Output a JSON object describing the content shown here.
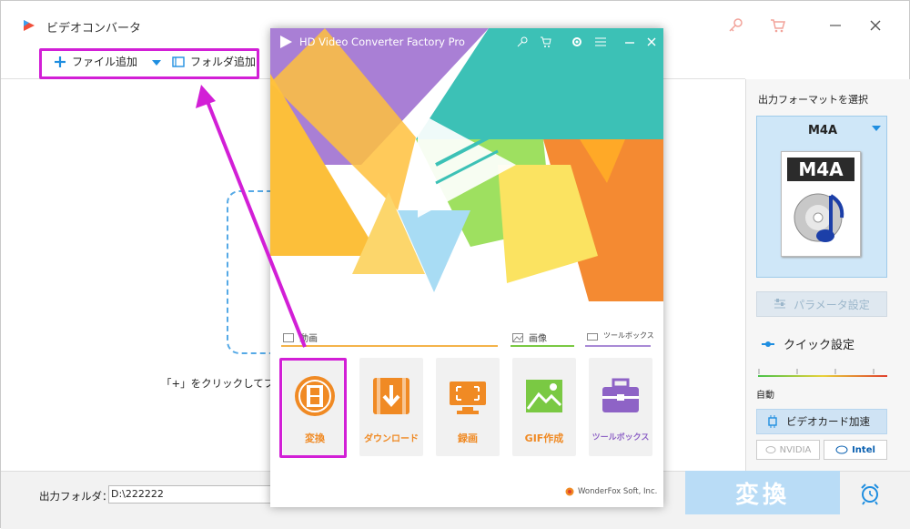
{
  "window": {
    "title": "ビデオコンバータ"
  },
  "toolbar": {
    "add_file": "ファイル追加",
    "add_folder": "フォルダ追加"
  },
  "main": {
    "hint": "「+」をクリックしてフ"
  },
  "output_format": {
    "label": "出力フォーマットを選択",
    "selected": "M4A",
    "icon_text": "M4A",
    "param_button": "パラメータ設定"
  },
  "quick_settings": {
    "label": "クイック設定",
    "auto": "自動"
  },
  "gpu": {
    "label": "ビデオカード加速",
    "vendors": [
      "NVIDIA",
      "Intel"
    ]
  },
  "bottom": {
    "output_label": "出力フォルダ：",
    "output_path": "D:\\222222",
    "convert": "変換"
  },
  "overlay": {
    "title": "HD Video Converter Factory Pro",
    "sections": {
      "video": "動画",
      "image": "画像",
      "toolbox": "ツールボックス"
    },
    "cards": [
      {
        "label": "変換",
        "color": "#f08a24"
      },
      {
        "label": "ダウンロード",
        "color": "#f08a24"
      },
      {
        "label": "録画",
        "color": "#f08a24"
      },
      {
        "label": "GIF作成",
        "color": "#f08a24"
      },
      {
        "label": "ツールボックス",
        "color": "#8e63c6"
      }
    ],
    "brand": "WonderFox Soft, Inc."
  },
  "colors": {
    "highlight": "#d21fd6",
    "accent": "#1f8ee0",
    "convert_bg": "#b9dcf6"
  }
}
